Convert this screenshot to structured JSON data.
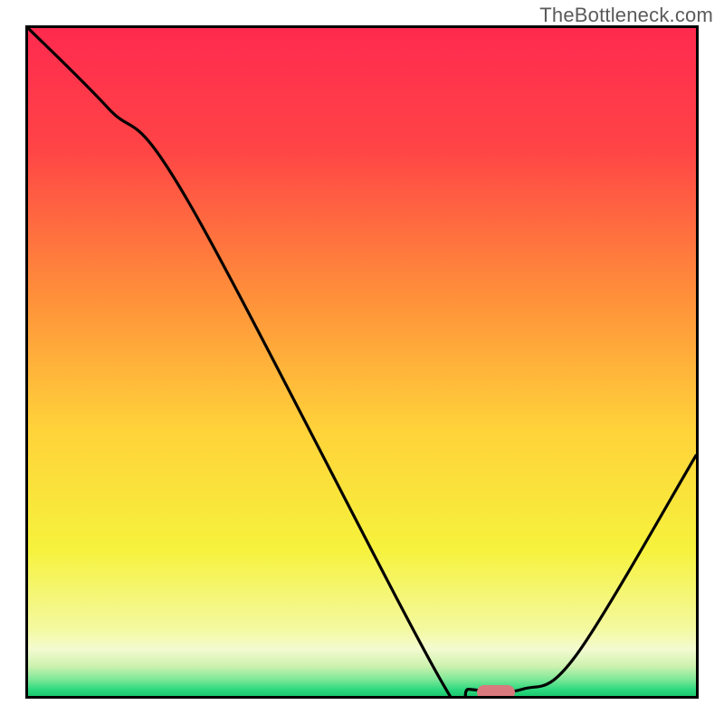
{
  "watermark": "TheBottleneck.com",
  "chart_data": {
    "type": "line",
    "title": "",
    "xlabel": "",
    "ylabel": "",
    "xlim": [
      0,
      100
    ],
    "ylim": [
      0,
      100
    ],
    "grid": false,
    "legend": false,
    "series": [
      {
        "name": "curve",
        "x": [
          0,
          12,
          24,
          62,
          66,
          74,
          82,
          100
        ],
        "values": [
          100,
          88,
          74,
          2,
          1,
          1,
          6,
          36
        ]
      }
    ],
    "marker": {
      "x": 70,
      "y": 0.5
    },
    "background": {
      "type": "vertical-gradient",
      "stops": [
        {
          "pos": 0.0,
          "color": "#ff2a4f"
        },
        {
          "pos": 0.18,
          "color": "#ff4446"
        },
        {
          "pos": 0.4,
          "color": "#ff8f3a"
        },
        {
          "pos": 0.6,
          "color": "#ffd23a"
        },
        {
          "pos": 0.78,
          "color": "#f6f23c"
        },
        {
          "pos": 0.9,
          "color": "#f4f9a0"
        },
        {
          "pos": 0.93,
          "color": "#f3fbd0"
        },
        {
          "pos": 0.955,
          "color": "#cef2b0"
        },
        {
          "pos": 0.975,
          "color": "#7fe898"
        },
        {
          "pos": 0.99,
          "color": "#2fd97f"
        },
        {
          "pos": 1.0,
          "color": "#19c96e"
        }
      ]
    },
    "colors": {
      "curve": "#000000",
      "marker": "#d97a7f",
      "border": "#000000"
    }
  }
}
